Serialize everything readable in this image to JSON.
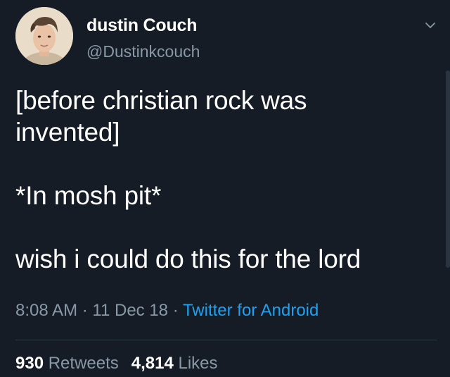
{
  "tweet": {
    "author": {
      "display_name": "dustin Couch",
      "handle": "@Dustinkcouch",
      "avatar_icon": "user-avatar"
    },
    "text": "[before christian rock was\ninvented]\n\n*In mosh pit*\n\nwish i could do this for the lord",
    "time": "8:08 AM",
    "separator": "·",
    "date": "11 Dec 18",
    "source": "Twitter for Android",
    "retweets_count": "930",
    "retweets_label": "Retweets",
    "likes_count": "4,814",
    "likes_label": "Likes"
  },
  "colors": {
    "background": "#151c26",
    "primary_text": "#ffffff",
    "secondary_text": "#8899a6",
    "link": "#1da1f2"
  }
}
